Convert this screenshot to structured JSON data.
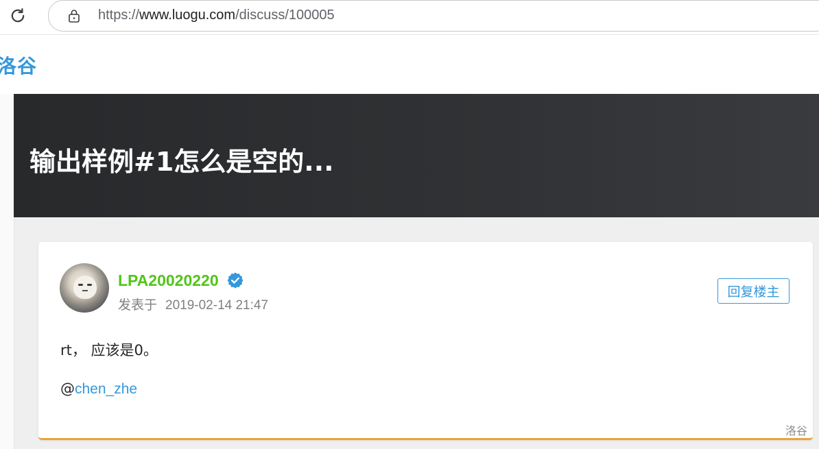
{
  "browser": {
    "url_prefix": "https://",
    "url_host": "www.luogu.com",
    "url_path": "/discuss/100005"
  },
  "header": {
    "logo_text": "洛谷"
  },
  "banner": {
    "title": "输出样例#1怎么是空的..."
  },
  "post": {
    "author": "LPA20020220",
    "author_color": "#52c41a",
    "verified_icon": "verified-badge-icon",
    "posted_label": "发表于",
    "posted_time": "2019-02-14 21:47",
    "reply_button": "回复楼主",
    "content_line1": "rt， 应该是0。",
    "mention_at": "@",
    "mention_user": "chen_zhe",
    "watermark": "洛谷"
  },
  "colors": {
    "accent": "#3498db",
    "card_bottom_border": "#e9a23b"
  }
}
